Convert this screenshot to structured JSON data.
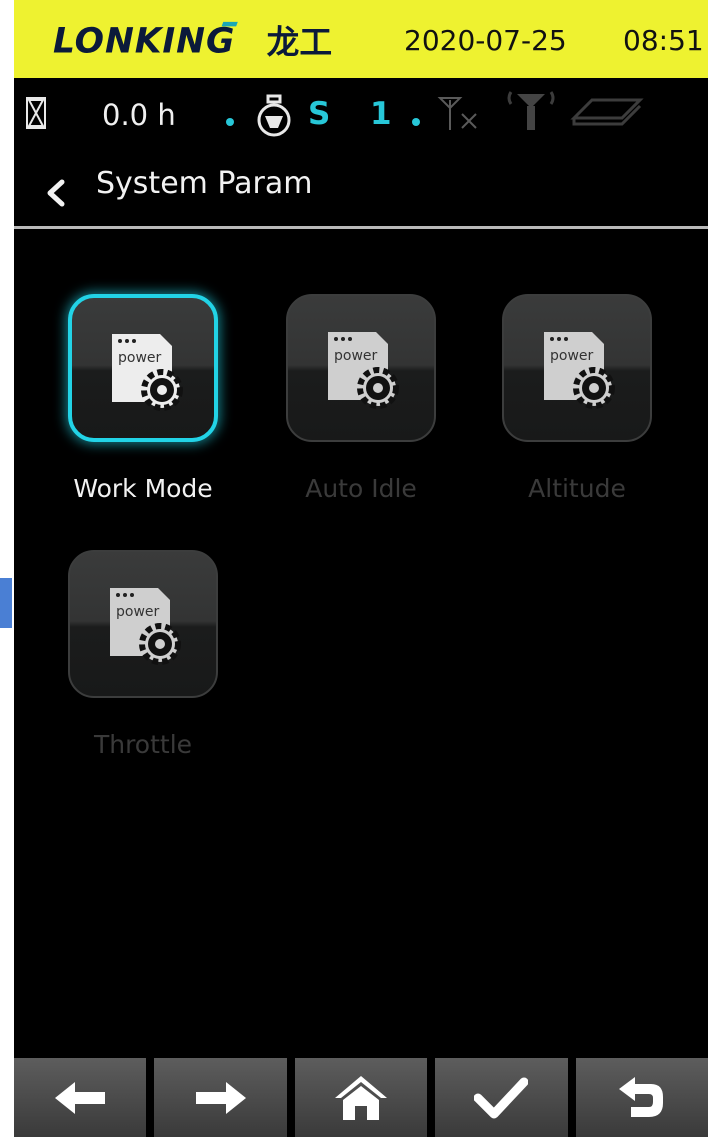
{
  "topbar": {
    "brand": "LONKING",
    "brand_cn": "龙工",
    "date": "2020-07-25",
    "time": "08:51",
    "background": "#eef230"
  },
  "status": {
    "hours": "0.0 h",
    "gear_letter": "S",
    "gear_number": "1",
    "accent_color": "#27c7d8",
    "icons": [
      "hourglass-icon",
      "engine-icon",
      "antenna-no-signal-icon",
      "antenna-signal-icon",
      "book-icon"
    ]
  },
  "header": {
    "title": "System Param",
    "back_icon": "chevron-left-icon"
  },
  "menu": {
    "items": [
      {
        "label": "Work Mode",
        "icon_text": "power",
        "active": true
      },
      {
        "label": "Auto Idle",
        "icon_text": "power",
        "active": false
      },
      {
        "label": "Altitude",
        "icon_text": "power",
        "active": false
      },
      {
        "label": "Throttle",
        "icon_text": "power",
        "active": false
      }
    ]
  },
  "navbar": {
    "buttons": [
      "arrow-left-icon",
      "arrow-right-icon",
      "home-icon",
      "check-icon",
      "return-icon"
    ]
  }
}
